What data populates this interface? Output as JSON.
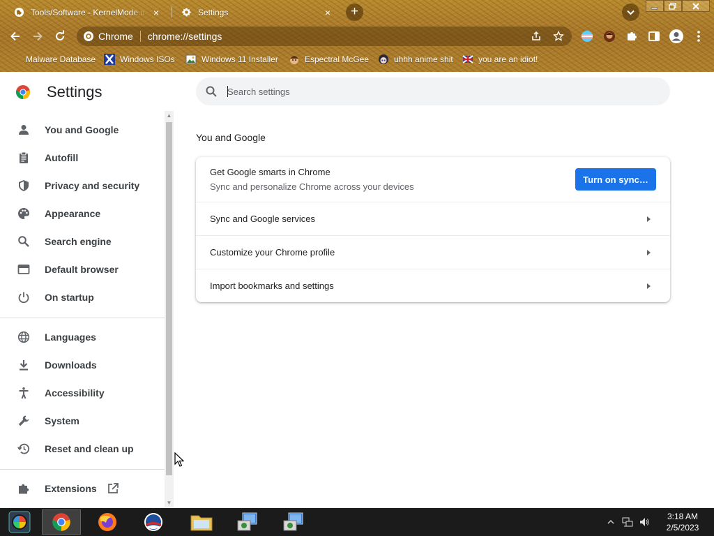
{
  "browser": {
    "tabs": [
      {
        "title": "Tools/Software - KernelMode.info",
        "active": false
      },
      {
        "title": "Settings",
        "active": true
      }
    ],
    "tab_close_glyph": "×",
    "newtab_glyph": "+",
    "omnibox": {
      "chip": "Chrome",
      "url": "chrome://settings"
    },
    "bookmarks": [
      {
        "label": "Malware Database",
        "icon": "no-icon"
      },
      {
        "label": "Windows ISOs",
        "icon": "x-logo-icon"
      },
      {
        "label": "Windows 11 Installer",
        "icon": "image-icon"
      },
      {
        "label": "Espectral McGee",
        "icon": "face-icon"
      },
      {
        "label": "uhhh anime shit",
        "icon": "anime-face-icon"
      },
      {
        "label": "you are an idiot!",
        "icon": "flag-icon"
      }
    ]
  },
  "settings": {
    "title": "Settings",
    "search_placeholder": "Search settings",
    "nav": [
      {
        "label": "You and Google",
        "icon": "person-icon"
      },
      {
        "label": "Autofill",
        "icon": "clipboard-icon"
      },
      {
        "label": "Privacy and security",
        "icon": "shield-icon"
      },
      {
        "label": "Appearance",
        "icon": "palette-icon"
      },
      {
        "label": "Search engine",
        "icon": "search-icon"
      },
      {
        "label": "Default browser",
        "icon": "browser-window-icon"
      },
      {
        "label": "On startup",
        "icon": "power-icon"
      },
      {
        "label": "Languages",
        "icon": "globe-icon"
      },
      {
        "label": "Downloads",
        "icon": "download-icon"
      },
      {
        "label": "Accessibility",
        "icon": "accessibility-icon"
      },
      {
        "label": "System",
        "icon": "wrench-icon"
      },
      {
        "label": "Reset and clean up",
        "icon": "history-icon"
      },
      {
        "label": "Extensions",
        "icon": "puzzle-icon"
      }
    ],
    "section_title": "You and Google",
    "sync_card": {
      "title": "Get Google smarts in Chrome",
      "subtitle": "Sync and personalize Chrome across your devices",
      "button": "Turn on sync…"
    },
    "rows": [
      {
        "label": "Sync and Google services"
      },
      {
        "label": "Customize your Chrome profile"
      },
      {
        "label": "Import bookmarks and settings"
      }
    ]
  },
  "taskbar": {
    "apps": [
      "start-orb",
      "chrome",
      "firefox",
      "obama-logo",
      "file-explorer",
      "installer",
      "installer"
    ],
    "clock_time": "3:18 AM",
    "clock_date": "2/5/2023"
  },
  "colors": {
    "accent": "#1a73e8",
    "text": "#202124",
    "theme": "#b0812c"
  }
}
